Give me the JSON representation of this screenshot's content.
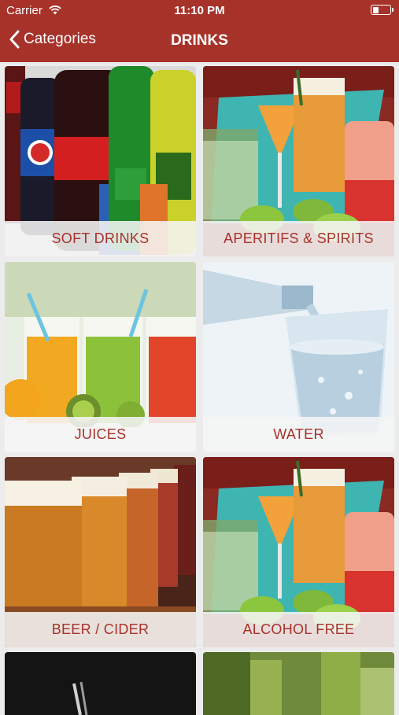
{
  "status_bar": {
    "carrier": "Carrier",
    "time": "11:10 PM",
    "battery_level": 0.35
  },
  "nav": {
    "back_label": "Categories",
    "title": "DRINKS"
  },
  "colors": {
    "brand": "#a7322a",
    "caption_text": "#a7322a",
    "caption_bg": "#f5f5f5"
  },
  "categories": [
    {
      "label": "SOFT DRINKS"
    },
    {
      "label": "APERITIFS & SPIRITS"
    },
    {
      "label": "JUICES"
    },
    {
      "label": "WATER"
    },
    {
      "label": "BEER / CIDER"
    },
    {
      "label": "ALCOHOL FREE"
    },
    {
      "label": ""
    },
    {
      "label": ""
    }
  ]
}
